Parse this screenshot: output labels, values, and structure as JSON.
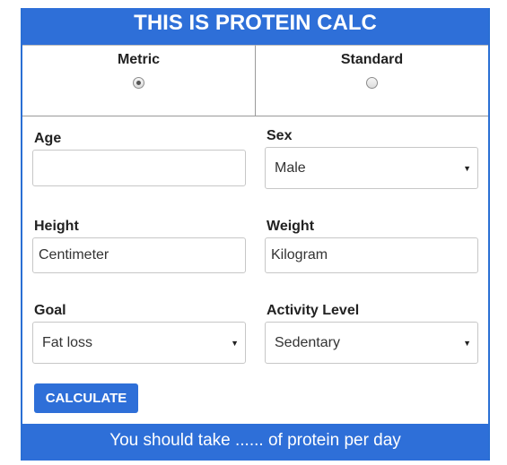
{
  "header": {
    "title": "THIS IS PROTEIN CALC"
  },
  "units": [
    {
      "label": "Metric",
      "checked": true
    },
    {
      "label": "Standard",
      "checked": false
    }
  ],
  "fields": {
    "age": {
      "label": "Age",
      "value": "",
      "placeholder": ""
    },
    "sex": {
      "label": "Sex",
      "selected": "Male"
    },
    "height": {
      "label": "Height",
      "placeholder": "Centimeter"
    },
    "weight": {
      "label": "Weight",
      "placeholder": "Kilogram"
    },
    "goal": {
      "label": "Goal",
      "selected": "Fat loss"
    },
    "activity": {
      "label": "Activity Level",
      "selected": "Sedentary"
    }
  },
  "icons": {
    "dropdown": "caret-down-icon",
    "radio": "radio-icon"
  },
  "actions": {
    "calculate_label": "CALCULATE"
  },
  "result": {
    "text": "You should take ...... of protein per day"
  },
  "colors": {
    "accent": "#2e6fd8",
    "border": "#2a6fd4"
  }
}
